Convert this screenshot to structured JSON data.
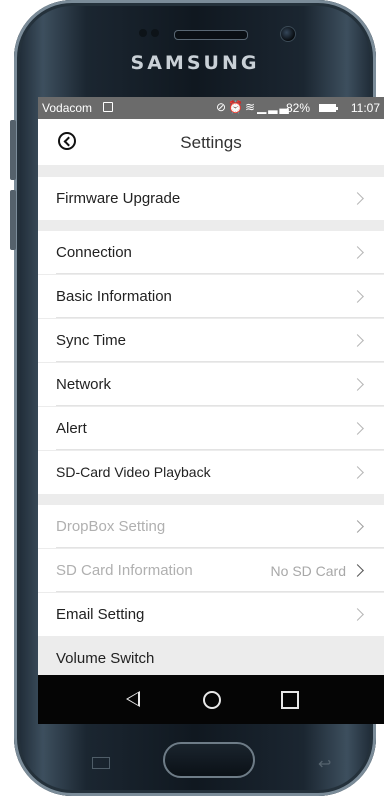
{
  "device": {
    "brand": "SAMSUNG",
    "colors": {
      "frame": "#1b2631",
      "accent": "#7b8c99"
    }
  },
  "status_bar": {
    "carrier": "Vodacom",
    "icons": [
      "nfc-icon",
      "alarm-icon",
      "wifi-icon",
      "signal-icon"
    ],
    "battery_percent": "82%",
    "time": "11:07",
    "background": "#6b6b6b"
  },
  "header": {
    "title": "Settings",
    "back_icon": "chevron-left-circle-icon"
  },
  "settings": {
    "items": [
      {
        "label": "Firmware Upgrade",
        "value": "",
        "enabled": true
      },
      {
        "label": "Connection",
        "value": "",
        "enabled": true
      },
      {
        "label": "Basic Information",
        "value": "",
        "enabled": true
      },
      {
        "label": "Sync Time",
        "value": "",
        "enabled": true
      },
      {
        "label": "Network",
        "value": "",
        "enabled": true
      },
      {
        "label": "Alert",
        "value": "",
        "enabled": true
      },
      {
        "label": "SD-Card Video Playback",
        "value": "",
        "enabled": true
      },
      {
        "label": "DropBox Setting",
        "value": "",
        "enabled": false
      },
      {
        "label": "SD Card Information",
        "value": "No SD Card",
        "enabled": false
      },
      {
        "label": "Email Setting",
        "value": "",
        "enabled": true
      },
      {
        "label": "Volume Switch",
        "value": "",
        "enabled": true
      }
    ]
  },
  "nav_bar": {
    "buttons": [
      "back-icon",
      "home-icon",
      "recent-apps-icon"
    ]
  }
}
